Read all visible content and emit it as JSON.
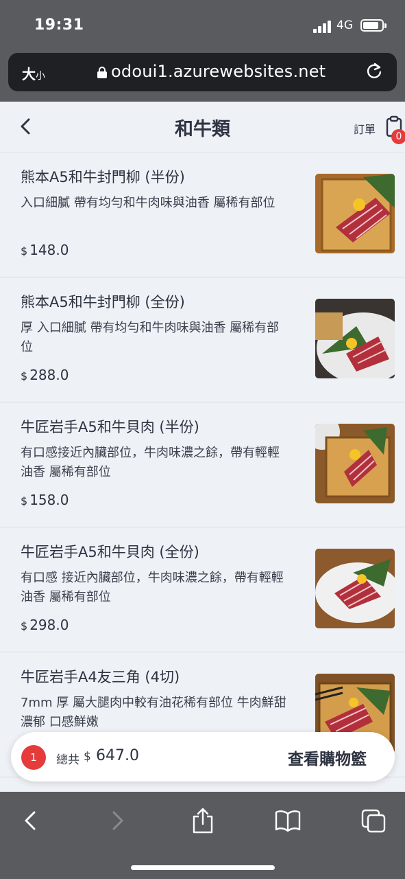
{
  "status_bar": {
    "time": "19:31",
    "network": "4G"
  },
  "browser": {
    "text_size_main": "大",
    "text_size_small": "小",
    "url": "odoui1.azurewebsites.net"
  },
  "header": {
    "title": "和牛類",
    "order_label": "訂單",
    "order_count": "0"
  },
  "menu": {
    "items": [
      {
        "name": "熊本A5和牛封門柳 (半份)",
        "description": "入口細膩 帶有均勻和牛肉味與油香 屬稀有部位",
        "currency": "$",
        "price": "148.0"
      },
      {
        "name": "熊本A5和牛封門柳 (全份)",
        "description": "厚 入口細膩 帶有均勻和牛肉味與油香 屬稀有部位",
        "currency": "$",
        "price": "288.0"
      },
      {
        "name": "牛匠岩手A5和牛貝肉 (半份)",
        "description": "有口感接近內臟部位，牛肉味濃之餘，帶有輕輕油香 屬稀有部位",
        "currency": "$",
        "price": "158.0"
      },
      {
        "name": "牛匠岩手A5和牛貝肉 (全份)",
        "description": "有口感 接近內臟部位，牛肉味濃之餘，帶有輕輕油香 屬稀有部位",
        "currency": "$",
        "price": "298.0"
      },
      {
        "name": "牛匠岩手A4友三角 (4切)",
        "description": "7mm 厚 屬大腿肉中較有油花稀有部位 牛肉鮮甜濃郁 口感鮮嫩",
        "currency": "$",
        "price": ""
      }
    ]
  },
  "cart": {
    "count": "1",
    "total_label": "總共",
    "currency": "$",
    "total": "647.0",
    "view_cart_label": "查看購物籃"
  },
  "colors": {
    "accent_red": "#e53b3b",
    "page_bg": "#eef1f6",
    "chrome_gray": "#5a5b5f",
    "url_bar": "#1f2024"
  },
  "icons": {
    "back": "chevron-left-icon",
    "orders": "clipboard-icon",
    "reload": "reload-icon",
    "lock": "lock-icon",
    "safari_back": "chevron-left-icon",
    "safari_forward": "chevron-right-icon",
    "share": "share-icon",
    "bookmarks": "book-icon",
    "tabs": "tabs-icon"
  }
}
